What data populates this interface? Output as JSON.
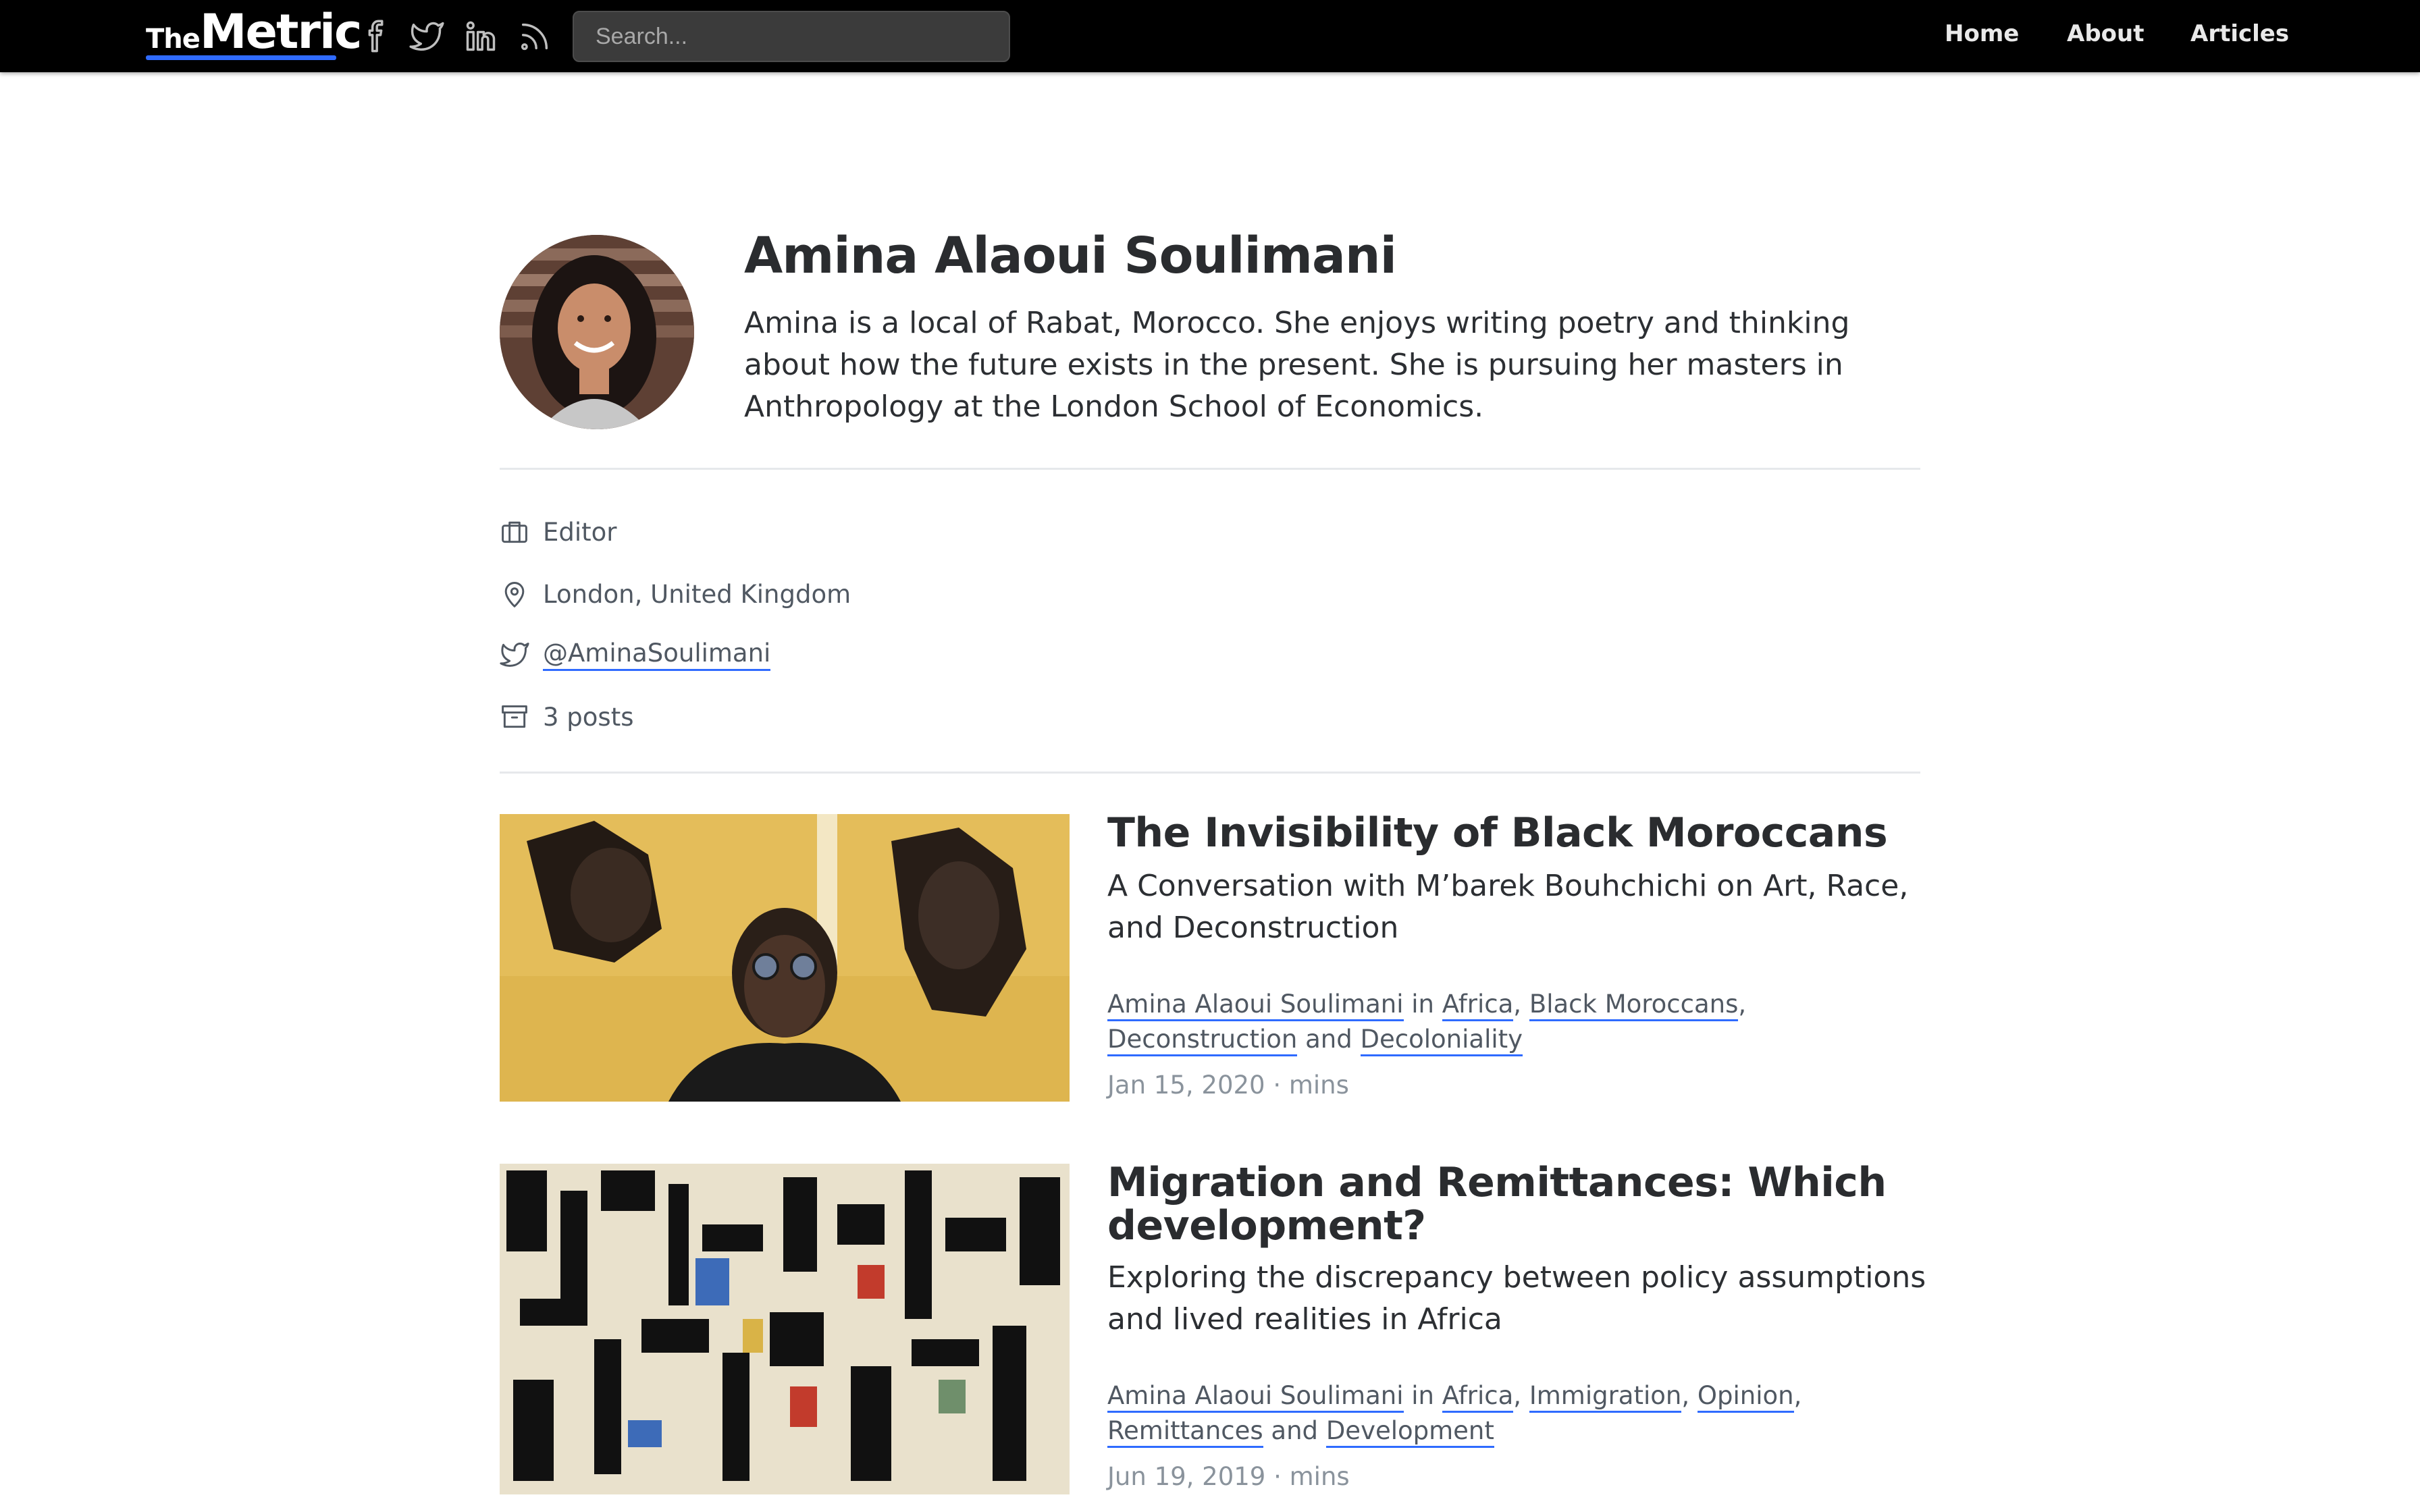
{
  "header": {
    "logo_the": "The",
    "logo_metric": "Metric",
    "social": [
      "facebook-icon",
      "twitter-icon",
      "linkedin-icon",
      "rss-icon"
    ],
    "search_placeholder": "Search...",
    "nav": [
      "Home",
      "About",
      "Articles"
    ]
  },
  "author": {
    "name": "Amina Alaoui Soulimani",
    "bio": "Amina is a local of Rabat, Morocco. She enjoys writing poetry and thinking about how the future exists in the present. She is pursuing her masters in Anthropology at the London School of Economics.",
    "role": "Editor",
    "location": "London, United Kingdom",
    "twitter": "@AminaSoulimani",
    "posts": "3 posts"
  },
  "posts": [
    {
      "title": "The Invisibility of Black Moroccans",
      "subtitle": "A Conversation with M’barek Bouhchichi on Art, Race, and Deconstruction",
      "author": "Amina Alaoui Soulimani",
      "in": "in",
      "tags": [
        "Africa",
        "Black Moroccans",
        "Deconstruction"
      ],
      "and": "and",
      "last_tag": "Decoloniality",
      "date": "Jan 15, 2020 · mins"
    },
    {
      "title": "Migration and Remittances: Which development?",
      "subtitle": "Exploring the discrepancy between policy assumptions and lived realities in Africa",
      "author": "Amina Alaoui Soulimani",
      "in": "in",
      "tags": [
        "Africa",
        "Immigration",
        "Opinion",
        "Remittances"
      ],
      "and": "and",
      "last_tag": "Development",
      "date": "Jun 19, 2019 · mins"
    }
  ],
  "colors": {
    "topbar": "#000000",
    "accent": "#2f6bff",
    "text": "#2a2c2f",
    "muted": "#505862"
  }
}
